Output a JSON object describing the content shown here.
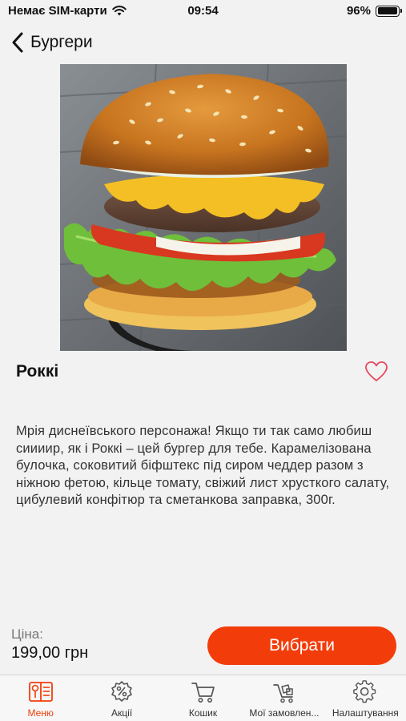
{
  "status_bar": {
    "carrier": "Немає SIM-карти",
    "time": "09:54",
    "battery": "96%",
    "battery_level": 0.96
  },
  "nav": {
    "back_label": "Бургери",
    "back_icon": "chevron-left-icon"
  },
  "product": {
    "title": "Роккі",
    "description": "Мрія диснеївського персонажа! Якщо ти так само любиш сиииир, як і Роккі – цей бургер для тебе. Карамелізована булочка, соковитий біфштекс під сиром чеддер разом з ніжною фетою, кільце томату, свіжий лист хрусткого салату, цибулевий конфітюр та сметанкова заправка, 300г.",
    "price_label": "Ціна:",
    "price": "199,00 грн",
    "favorite_icon": "heart-outline-icon"
  },
  "actions": {
    "choose_label": "Вибрати"
  },
  "tabbar": {
    "items": [
      {
        "label": "Меню",
        "icon": "menu-book-icon",
        "active": true
      },
      {
        "label": "Акції",
        "icon": "discount-icon",
        "active": false
      },
      {
        "label": "Кошик",
        "icon": "cart-icon",
        "active": false
      },
      {
        "label": "Мої замовлен...",
        "icon": "orders-cart-icon",
        "active": false
      },
      {
        "label": "Налаштування",
        "icon": "gear-icon",
        "active": false
      }
    ]
  },
  "colors": {
    "accent": "#f23d0b",
    "background": "#f2f2f2",
    "favorite": "#e8475f"
  }
}
